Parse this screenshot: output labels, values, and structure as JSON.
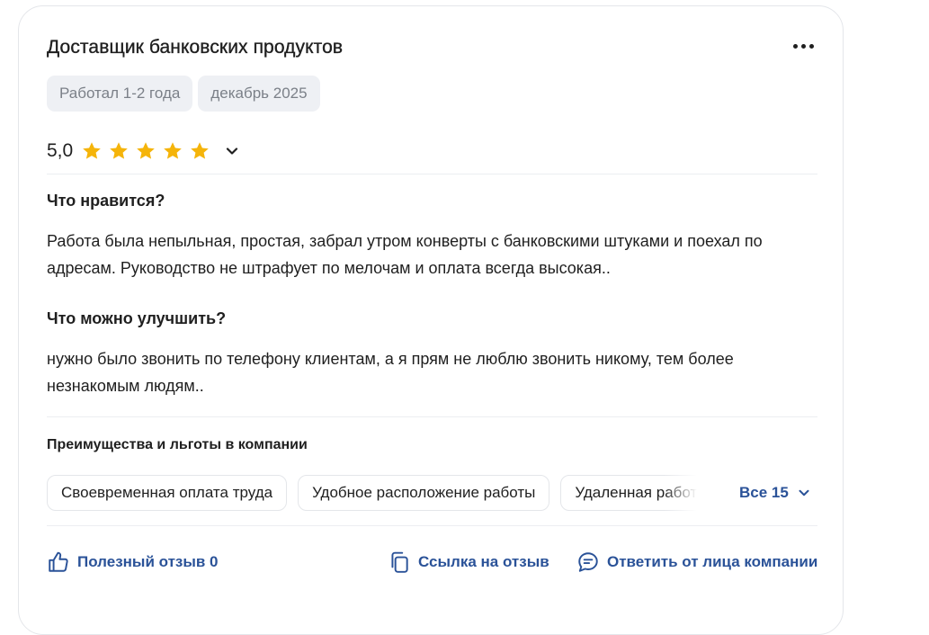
{
  "review": {
    "position": "Доставщик банковских продуктов",
    "tags": [
      "Работал 1-2 года",
      "декабрь 2025"
    ],
    "rating": {
      "value": "5,0",
      "stars": 5,
      "max_stars": 5,
      "star_color": "#f5b40a"
    },
    "likes": {
      "title": "Что нравится?",
      "text": "Работа была непыльная, простая, забрал утром конверты с банковскими штуками и поехал по адресам. Руководство не штрафует по мелочам и оплата всегда высокая.."
    },
    "improve": {
      "title": "Что можно улучшить?",
      "text": "нужно было звонить по телефону клиентам, а я прям не люблю звонить никому, тем более незнакомым людям.."
    },
    "benefits": {
      "title": "Преимущества и льготы в компании",
      "chips": [
        "Своевременная оплата труда",
        "Удобное расположение работы",
        "Удаленная работа"
      ],
      "all_label": "Все 15"
    },
    "actions": {
      "helpful": "Полезный отзыв 0",
      "link": "Ссылка на отзыв",
      "reply": "Ответить от лица компании"
    }
  },
  "icons": {
    "more": "more-horizontal-icon",
    "chevron": "chevron-down-icon",
    "helpful": "thumbs-up-icon",
    "link": "copy-icon",
    "reply": "chat-bubble-icon"
  },
  "colors": {
    "accent": "#2a5298",
    "tag_bg": "#eef0f4",
    "tag_text": "#7b8088",
    "border": "#e4e6ea"
  }
}
